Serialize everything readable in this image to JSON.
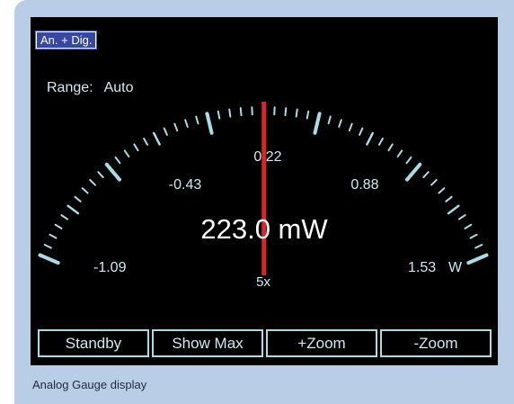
{
  "screen": {
    "mode_badge": "An. + Dig.",
    "range_label": "Range:",
    "range_value": "Auto",
    "scale_labels": [
      "-1.09",
      "-0.43",
      "0.22",
      "0.88",
      "1.53"
    ],
    "unit": "W",
    "zoom_factor": "5x",
    "reading": "223.0 mW",
    "needle_value": 0.223,
    "scale_min": -1.09,
    "scale_max": 1.53
  },
  "softkeys": [
    "Standby",
    "Show Max",
    "+Zoom",
    "-Zoom"
  ],
  "caption": "Analog Gauge display",
  "colors": {
    "frame": "#b9cee6",
    "screen": "#000000",
    "scale": "#a8dde6",
    "needle": "#d8262a",
    "badge": "#3848a0"
  }
}
